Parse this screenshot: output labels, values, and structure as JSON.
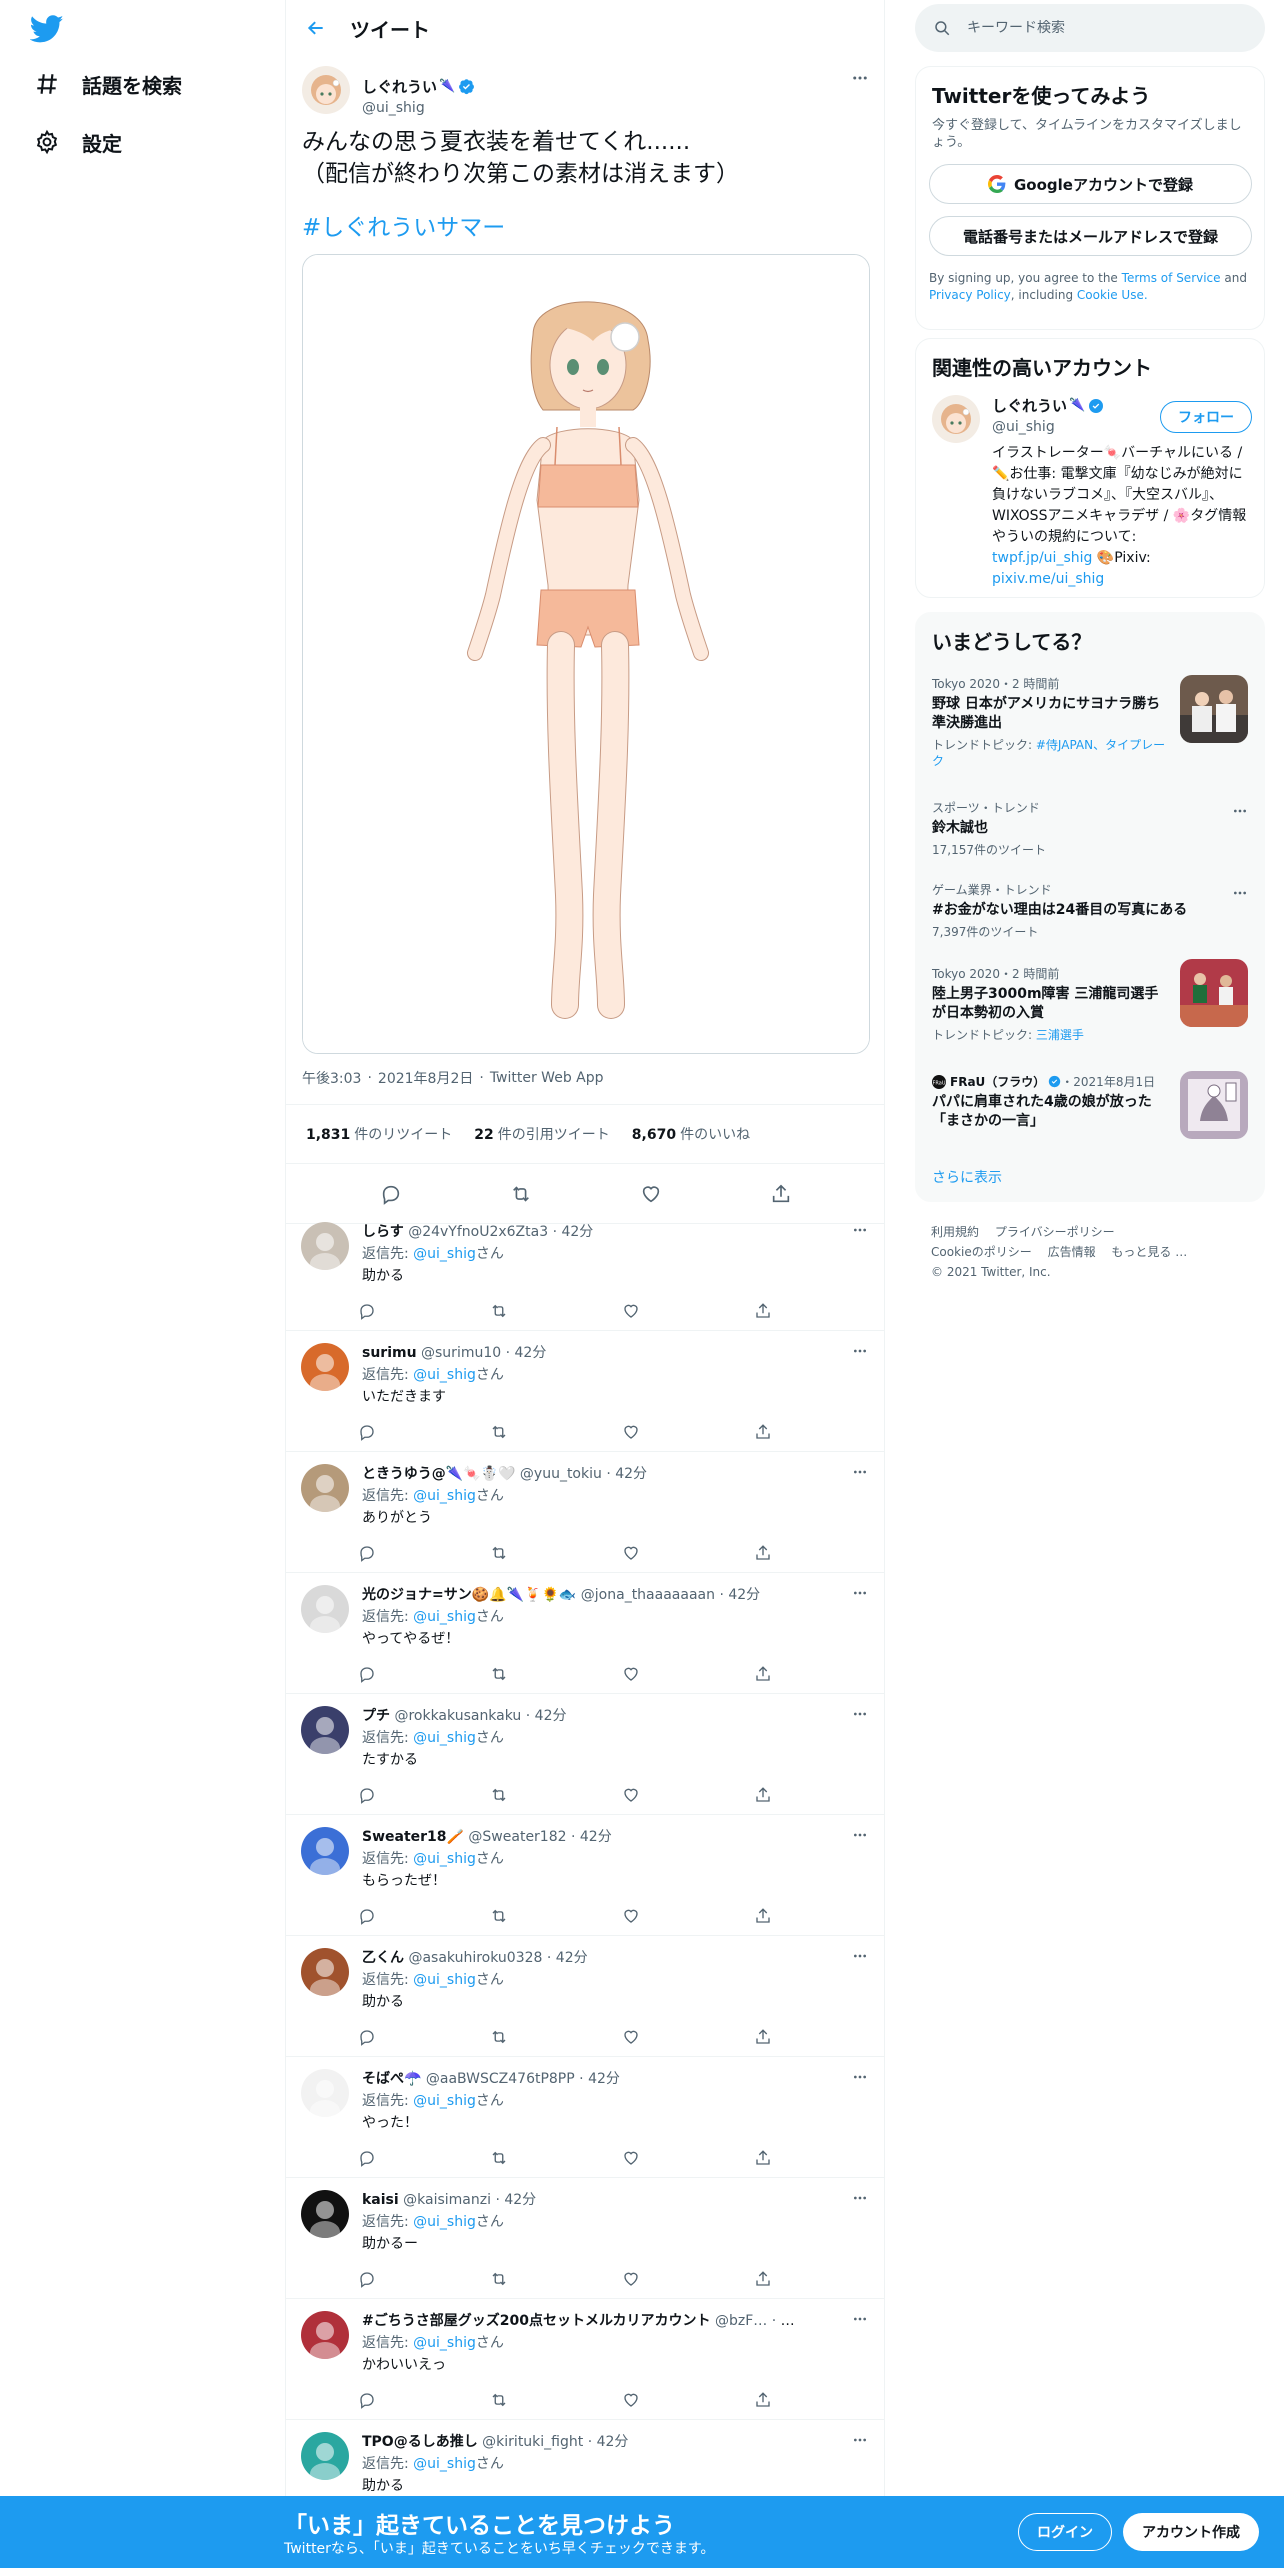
{
  "nav": {
    "items": [
      {
        "label": "話題を検索",
        "icon": "hashtag-icon"
      },
      {
        "label": "設定",
        "icon": "gear-icon"
      }
    ]
  },
  "header": {
    "title": "ツイート"
  },
  "tweet": {
    "author_name": "しぐれうい",
    "author_handle": "@ui_shig",
    "text": "みんなの思う夏衣装を着せてくれ......\n（配信が終わり次第この素材は消えます）",
    "hashtag": "#しぐれういサマー",
    "time": "午後3:03",
    "date": "2021年8月2日",
    "source": "Twitter Web App",
    "stats": {
      "retweets_count": "1,831",
      "retweets_label": "件のリツイート",
      "quotes_count": "22",
      "quotes_label": "件の引用ツイート",
      "likes_count": "8,670",
      "likes_label": "件のいいね"
    }
  },
  "reply_to_label": "返信先:",
  "reply_to_handle": "@ui_shig",
  "reply_to_suffix": "さん",
  "replies": [
    {
      "name": "しらす",
      "handle": "@24vYfnoU2x6Zta3",
      "time": "42分",
      "text": "助かる",
      "avatar_color": "#c9c0b5"
    },
    {
      "name": "surimu",
      "handle": "@surimu10",
      "time": "42分",
      "text": "いただきます",
      "avatar_color": "#d86a2b"
    },
    {
      "name": "ときうゆう@🌂🍬☃️🤍",
      "handle": "@yuu_tokiu",
      "time": "42分",
      "text": "ありがとう",
      "avatar_color": "#b59a7a"
    },
    {
      "name": "光のジョナ=サン🍪🔔🌂🍹🌻🐟",
      "handle": "@jona_thaaaaaaan",
      "time": "42分",
      "text": "やってやるぜ！",
      "avatar_color": "#d9d9d9"
    },
    {
      "name": "プチ",
      "handle": "@rokkakusankaku",
      "time": "42分",
      "text": "たすかる",
      "avatar_color": "#3a3f6b"
    },
    {
      "name": "Sweater18🪥",
      "handle": "@Sweater182",
      "time": "42分",
      "text": "もらったぜ！",
      "avatar_color": "#3b6fd6"
    },
    {
      "name": "乙くん",
      "handle": "@asakuhiroku0328",
      "time": "42分",
      "text": "助かる",
      "avatar_color": "#a0522d"
    },
    {
      "name": "そばぺ☂️",
      "handle": "@aaBWSCZ476tP8PP",
      "time": "42分",
      "text": "やった！",
      "avatar_color": "#f2f2f2"
    },
    {
      "name": "kaisi",
      "handle": "@kaisimanzi",
      "time": "42分",
      "text": "助かるー",
      "avatar_color": "#111111"
    },
    {
      "name": "#ごちうさ部屋グッズ200点セットメルカリアカウント",
      "handle": "@bzF…",
      "time": "42分",
      "text": "かわいいえっ",
      "avatar_color": "#b0303a"
    },
    {
      "name": "TPO@るしあ推し",
      "handle": "@kirituki_fight",
      "time": "42分",
      "text": "助かる",
      "avatar_color": "#2aa7a0"
    }
  ],
  "search": {
    "placeholder": "キーワード検索"
  },
  "signup": {
    "title": "Twitterを使ってみよう",
    "subtitle": "今すぐ登録して、タイムラインをカスタマイズしましょう。",
    "google_button": "Googleアカウントで登録",
    "phone_button": "電話番号またはメールアドレスで登録",
    "legal_prefix": "By signing up, you agree to the",
    "terms": "Terms of Service",
    "and": "and",
    "privacy": "Privacy Policy",
    "including": ", including",
    "cookie": "Cookie Use."
  },
  "related": {
    "title": "関連性の高いアカウント",
    "name": "しぐれうい",
    "handle": "@ui_shig",
    "follow_button": "フォロー",
    "bio": "イラストレーター🍬バーチャルにいる / ✏️お仕事: 電撃文庫『幼なじみが絶対に負けないラブコメ』、『大空スバル』、WIXOSSアニメキャラデザ / 🌸タグ情報やういの規約について:",
    "link1": "twpf.jp/ui_shig",
    "link2_prefix": "🎨Pixiv:",
    "link2": "pixiv.me/ui_shig"
  },
  "trends": {
    "title": "いまどうしてる？",
    "items": [
      {
        "meta": "Tokyo 2020・2 時間前",
        "title": "野球 日本がアメリカにサヨナラ勝ち 準決勝進出",
        "sub_prefix": "トレンドトピック:",
        "sub_link": "#侍JAPAN、タイプレーク",
        "image": "baseball"
      },
      {
        "meta": "スポーツ・トレンド",
        "title": "鈴木誠也",
        "sub": "17,157件のツイート"
      },
      {
        "meta": "ゲーム業界・トレンド",
        "title": "#お金がない理由は24番目の写真にある",
        "sub": "7,397件のツイート"
      },
      {
        "meta": "Tokyo 2020・2 時間前",
        "title": "陸上男子3000m障害 三浦龍司選手が日本勢初の入賞",
        "sub_prefix": "トレンドトピック:",
        "sub_link": "三浦選手",
        "image": "athletics"
      },
      {
        "meta_source": "FRaU（フラウ）",
        "meta_date": "・2021年8月1日",
        "title": "パパに肩車された4歳の娘が放った「まさかの一言」",
        "image": "comic"
      }
    ],
    "show_more": "さらに表示"
  },
  "footer": {
    "links": [
      "利用規約",
      "プライバシーポリシー",
      "Cookieのポリシー",
      "広告情報",
      "もっと見る …"
    ],
    "copyright": "© 2021 Twitter, Inc."
  },
  "bottom_bar": {
    "title": "「いま」起きていることを見つけよう",
    "subtitle": "Twitterなら、「いま」起きていることをいち早くチェックできます。",
    "login": "ログイン",
    "signup": "アカウント作成"
  },
  "colors": {
    "accent": "#1d9bf0",
    "text": "#0f1419",
    "muted": "#536471",
    "border": "#eff3f4"
  }
}
